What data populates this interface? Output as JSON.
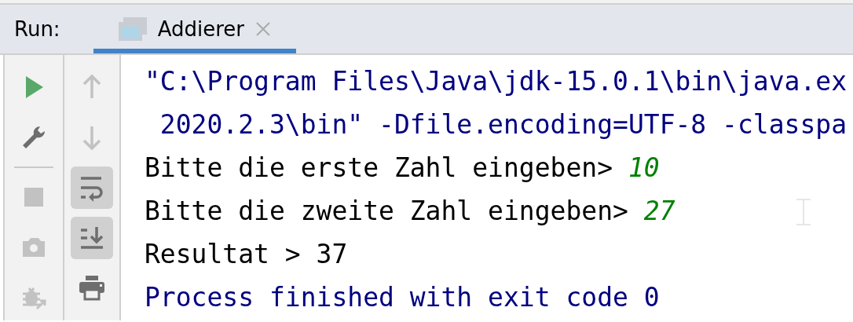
{
  "run_panel": {
    "label": "Run:",
    "tabs": [
      {
        "label": "Addierer",
        "selected": true
      }
    ]
  },
  "toolbar_left": [
    {
      "kind": "run",
      "disabled": false
    },
    {
      "kind": "settings",
      "disabled": false
    },
    {
      "kind": "separator"
    },
    {
      "kind": "stop",
      "disabled": true
    },
    {
      "kind": "camera",
      "disabled": true
    },
    {
      "kind": "debug",
      "disabled": true
    }
  ],
  "toolbar_right": [
    {
      "kind": "up",
      "disabled": true,
      "toggled": false
    },
    {
      "kind": "down",
      "disabled": true,
      "toggled": false
    },
    {
      "kind": "wrap",
      "disabled": false,
      "toggled": true
    },
    {
      "kind": "scroll-end",
      "disabled": false,
      "toggled": true
    },
    {
      "kind": "print",
      "disabled": false,
      "toggled": false
    }
  ],
  "console": [
    {
      "segments": [
        {
          "kind": "system",
          "text": "\"C:\\Program Files\\Java\\jdk-15.0.1\\bin\\java.ex"
        }
      ]
    },
    {
      "segments": [
        {
          "kind": "system",
          "text": " 2020.2.3\\bin\" -Dfile.encoding=UTF-8 -classpa"
        }
      ]
    },
    {
      "segments": [
        {
          "kind": "stdout",
          "text": "Bitte die erste Zahl eingeben> "
        },
        {
          "kind": "stdin",
          "text": "10"
        }
      ]
    },
    {
      "segments": [
        {
          "kind": "stdout",
          "text": "Bitte die zweite Zahl eingeben> "
        },
        {
          "kind": "stdin",
          "text": "27"
        }
      ]
    },
    {
      "segments": [
        {
          "kind": "stdout",
          "text": "Resultat > 37"
        }
      ]
    },
    {
      "segments": [
        {
          "kind": "system",
          "text": "Process finished with exit code 0"
        }
      ]
    }
  ]
}
